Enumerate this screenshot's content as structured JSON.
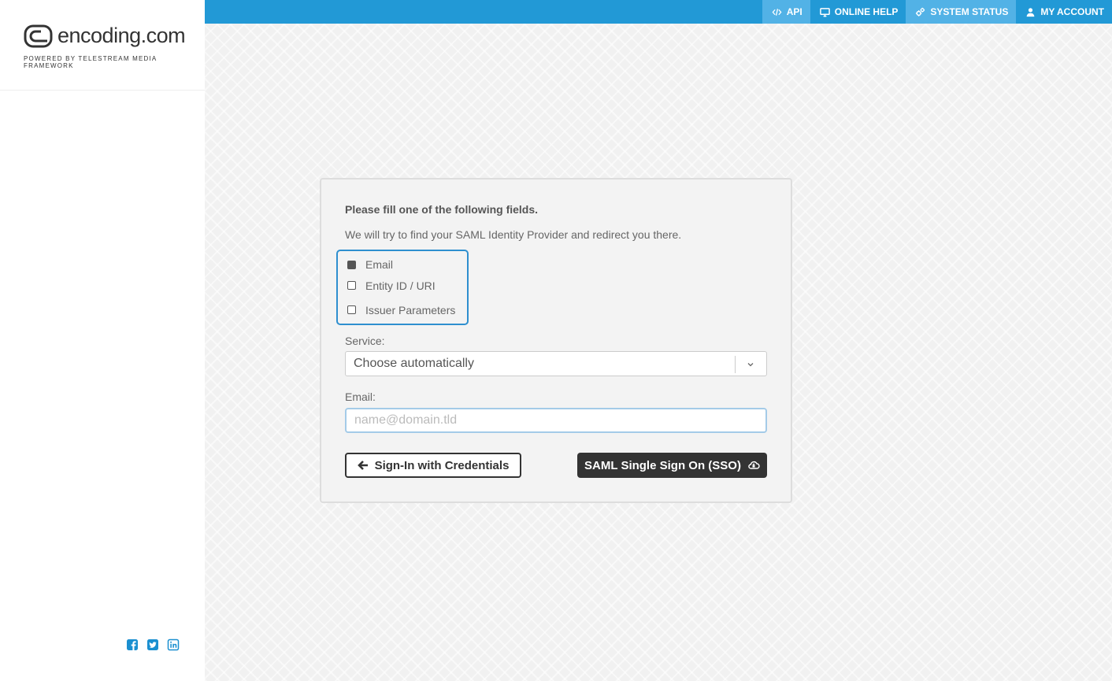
{
  "brand": {
    "name": "encoding.com",
    "tagline": "POWERED BY TELESTREAM MEDIA FRAMEWORK"
  },
  "topnav": {
    "items": [
      {
        "label": "API",
        "icon": "code-icon"
      },
      {
        "label": "ONLINE HELP",
        "icon": "monitor-icon"
      },
      {
        "label": "SYSTEM STATUS",
        "icon": "gears-icon"
      },
      {
        "label": "MY ACCOUNT",
        "icon": "user-icon"
      }
    ]
  },
  "form": {
    "title": "Please fill one of the following fields.",
    "description": "We will try to find your SAML Identity Provider and redirect you there.",
    "options": [
      {
        "label": "Email",
        "checked": true
      },
      {
        "label": "Entity ID / URI",
        "checked": false
      },
      {
        "label": "Issuer Parameters",
        "checked": false
      }
    ],
    "service_label": "Service:",
    "service_value": "Choose automatically",
    "email_label": "Email:",
    "email_placeholder": "name@domain.tld",
    "back_button": "Sign-In with Credentials",
    "sso_button": "SAML Single Sign On (SSO)"
  },
  "social": [
    "facebook-icon",
    "twitter-icon",
    "linkedin-icon"
  ],
  "colors": {
    "topbar": "#2299d6",
    "topbar_light": "#52b2e6",
    "accent_border": "#2e8fcf",
    "sso_button": "#333333",
    "social": "#1a8fd0"
  }
}
